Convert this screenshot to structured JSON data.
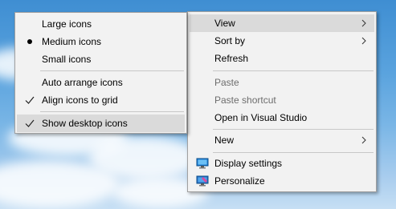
{
  "view_submenu": {
    "items": [
      {
        "label": "Large icons"
      },
      {
        "label": "Medium icons",
        "selected": true
      },
      {
        "label": "Small icons"
      },
      {
        "label": "Auto arrange icons"
      },
      {
        "label": "Align icons to grid",
        "checked": true
      },
      {
        "label": "Show desktop icons",
        "checked": true,
        "highlighted": true
      }
    ]
  },
  "context_menu": {
    "items": [
      {
        "label": "View",
        "has_submenu": true,
        "highlighted": true
      },
      {
        "label": "Sort by",
        "has_submenu": true
      },
      {
        "label": "Refresh"
      },
      {
        "label": "Paste",
        "disabled": true
      },
      {
        "label": "Paste shortcut",
        "disabled": true
      },
      {
        "label": "Open in Visual Studio"
      },
      {
        "label": "New",
        "has_submenu": true
      },
      {
        "label": "Display settings",
        "icon": "display-settings-icon"
      },
      {
        "label": "Personalize",
        "icon": "personalize-icon"
      }
    ]
  },
  "colors": {
    "menu_bg": "#f2f2f2",
    "highlight": "#dadada",
    "disabled_text": "#6d6d6d",
    "separator": "#c8c8c8"
  }
}
